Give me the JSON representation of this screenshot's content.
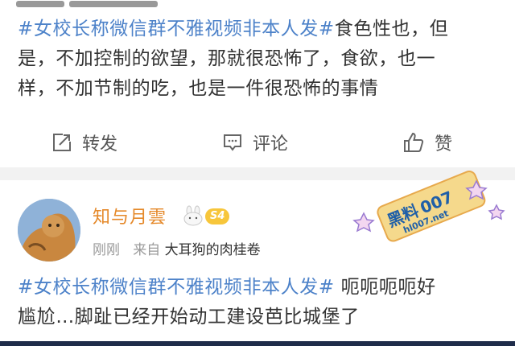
{
  "post1": {
    "topic": "#女校长称微信群不雅视频非本人发#",
    "text_line1": "食色性也，但",
    "text_line2": "是，不加控制的欲望，那就很恐怖了，食欲，也一",
    "text_line3": "样，不加节制的吃，也是一件很恐怖的事情"
  },
  "actions": {
    "repost": "转发",
    "comment": "评论",
    "like": "赞"
  },
  "post2": {
    "username": "知与月雲",
    "level_badge": "S4",
    "time": "刚刚",
    "source_prefix": "来自",
    "source": "大耳狗的肉桂卷",
    "topic": "#女校长称微信群不雅视频非本人发#",
    "text_line1": "呃呃呃呃好",
    "text_line2": "尴尬…脚趾已经开始动工建设芭比城堡了"
  },
  "watermark": {
    "text1": "黑料",
    "text2": "007",
    "text3": "hl007.net"
  },
  "colors": {
    "topic": "#4d82c9",
    "username": "#e5892a",
    "badge": "#f7c63b",
    "divider": "#f2f2f2"
  }
}
